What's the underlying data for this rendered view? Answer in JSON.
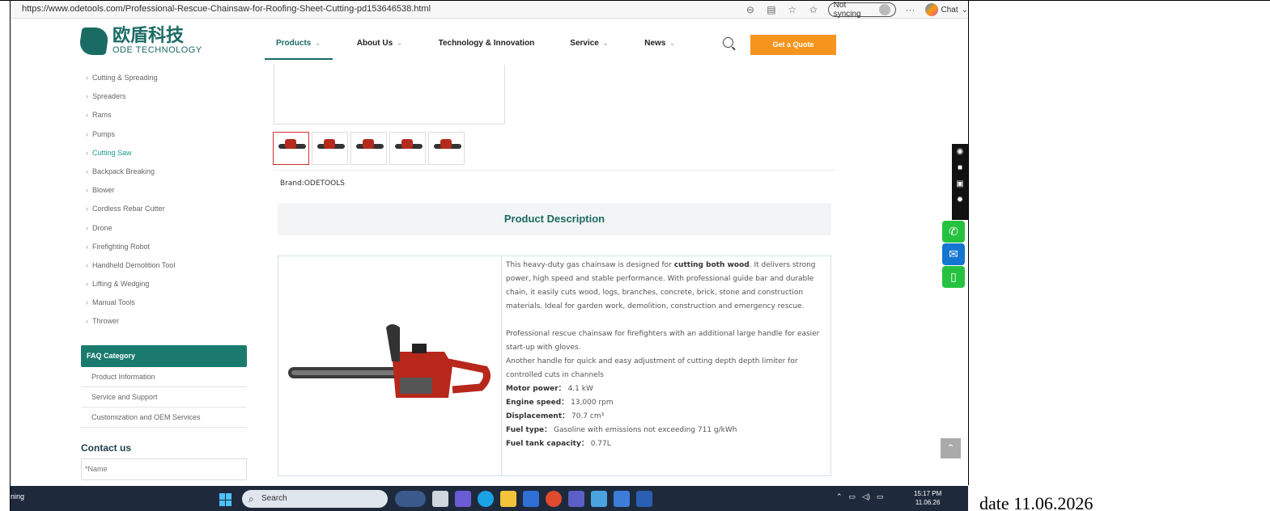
{
  "browser": {
    "url": "https://www.odetools.com/Professional-Rescue-Chainsaw-for-Roofing-Sheet-Cutting-pd153646538.html",
    "sync_label": "Not syncing",
    "chat_label": "Chat",
    "more_label": "···"
  },
  "header": {
    "logo_cn": "欧盾科技",
    "logo_en": "ODE TECHNOLOGY",
    "nav": [
      {
        "label": "Products",
        "chevron": "⌄"
      },
      {
        "label": "About Us",
        "chevron": "⌄"
      },
      {
        "label": "Technology & Innovation",
        "chevron": ""
      },
      {
        "label": "Service",
        "chevron": "⌄"
      },
      {
        "label": "News",
        "chevron": "⌄"
      }
    ],
    "quote_label": "Get a Quote",
    "active_tab": "Products"
  },
  "sidebar": {
    "categories": [
      "Cutting & Spreading",
      "Spreaders",
      "Rams",
      "Pumps",
      "Cutting Saw",
      "Backpack Breaking",
      "Blower",
      "Cordless Rebar Cutter",
      "Drone",
      "Firefighting Robot",
      "Handheld Demolition Tool",
      "Lifting & Wedging",
      "Manual Tools",
      "Thrower"
    ],
    "active_category": "Cutting Saw",
    "faq_title": "FAQ Category",
    "faq_items": [
      "Product Information",
      "Service and Support",
      "Customization and OEM Services"
    ],
    "contact_title": "Contact us",
    "name_placeholder": "*Name"
  },
  "product": {
    "brand": "Brand:ODETOOLS",
    "description_title": "Product Description",
    "para1_a": "This heavy-duty gas chainsaw is designed for ",
    "para1_b": "cutting both wood",
    "para1_c": ". It delivers strong power, high speed and stable performance. With professional guide bar and durable chain, it easily cuts wood, logs, branches, concrete, brick, stone and construction materials. Ideal for garden work, demolition, construction and emergency rescue.",
    "para2": "Professional rescue chainsaw for firefighters with an additional large handle for easier start-up with gloves.",
    "para3": "Another handle for quick and easy adjustment of cutting depth depth limiter for controlled cuts in channels",
    "specs": [
      {
        "label": "Motor power：",
        "value": "4.1 kW"
      },
      {
        "label": "Engine speed：",
        "value": "13,000 rpm"
      },
      {
        "label": "Displacement：",
        "value": "70.7 cm³"
      },
      {
        "label": "Fuel type：",
        "value": "Gasoline with emissions not exceeding 711 g/kWh"
      },
      {
        "label": "Fuel tank capacity：",
        "value": "0.77L"
      }
    ]
  },
  "taskbar": {
    "left_text": "ning",
    "search_placeholder": "Search",
    "time": "15:17 PM",
    "date": "11.06.26"
  },
  "caption": "date 11.06.2026",
  "colors": {
    "brand": "#1a6b63",
    "accent": "#f7941d"
  }
}
